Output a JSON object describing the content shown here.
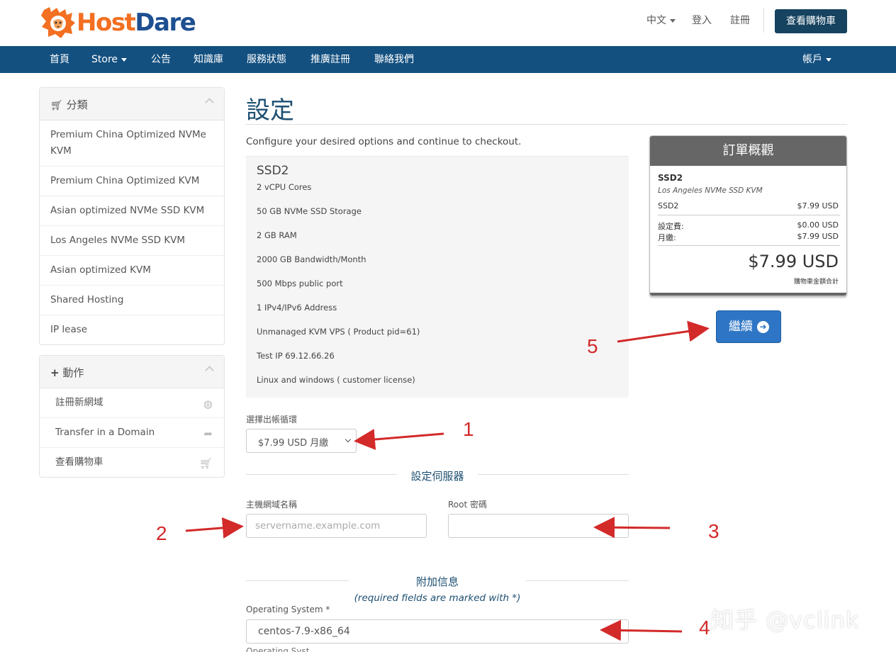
{
  "brand": {
    "name_part1": "Host",
    "name_part2": "Dare",
    "orange": "#f36f21",
    "blue": "#1d4f91"
  },
  "header": {
    "language": "中文",
    "login": "登入",
    "register": "註冊",
    "view_cart": "查看購物車"
  },
  "nav": {
    "items": [
      "首頁",
      "Store",
      "公告",
      "知識庫",
      "服務狀態",
      "推廣註冊",
      "聯絡我們"
    ],
    "account": "帳戶",
    "color": "#135080"
  },
  "sidebar": {
    "categories_title": "分類",
    "categories": [
      "Premium China Optimized NVMe KVM",
      "Premium China Optimized KVM",
      "Asian optimized NVMe SSD KVM",
      "Los Angeles NVMe SSD KVM",
      "Asian optimized KVM",
      "Shared Hosting",
      "IP lease"
    ],
    "actions_title": "動作",
    "actions": [
      {
        "label": "註冊新網域",
        "icon": "globe-icon"
      },
      {
        "label": "Transfer in a Domain",
        "icon": "share-arrow-icon"
      },
      {
        "label": "查看購物車",
        "icon": "cart-icon"
      }
    ]
  },
  "main": {
    "title": "設定",
    "intro": "Configure your desired options and continue to checkout.",
    "product": {
      "name": "SSD2",
      "features": [
        "2 vCPU Cores",
        "50 GB NVMe SSD Storage",
        "2 GB RAM",
        "2000 GB Bandwidth/Month",
        "500 Mbps public port",
        "1 IPv4/IPv6 Address",
        "Unmanaged KVM VPS ( Product pid=61)",
        "Test IP 69.12.66.26",
        "Linux and windows ( customer license)"
      ]
    },
    "billing_cycle_label": "選擇出帳循環",
    "billing_cycle_value": "$7.99 USD 月繳",
    "server_section_title": "設定伺服器",
    "hostname_label": "主機網域名稱",
    "hostname_placeholder": "servername.example.com",
    "root_password_label": "Root 密碼",
    "root_password_value": "",
    "additional_section_title": "附加信息",
    "required_note": "(required fields are marked with *)",
    "os_label": "Operating System *",
    "os_value": "centos-7.9-x86_64",
    "os_more": "⋯",
    "next_label_cut": "Operating Syst"
  },
  "summary": {
    "title": "訂單概觀",
    "product_name": "SSD2",
    "product_group": "Los Angeles NVMe SSD KVM",
    "line_item": "SSD2",
    "line_price": "$7.99 USD",
    "setup_label": "設定費:",
    "setup_value": "$0.00 USD",
    "monthly_label": "月繳:",
    "monthly_value": "$7.99 USD",
    "total": "$7.99 USD",
    "total_label": "購物車金額合計",
    "continue_label": "繼續"
  },
  "annotations": [
    "1",
    "2",
    "3",
    "4",
    "5"
  ],
  "watermark": "知乎 @vclink"
}
